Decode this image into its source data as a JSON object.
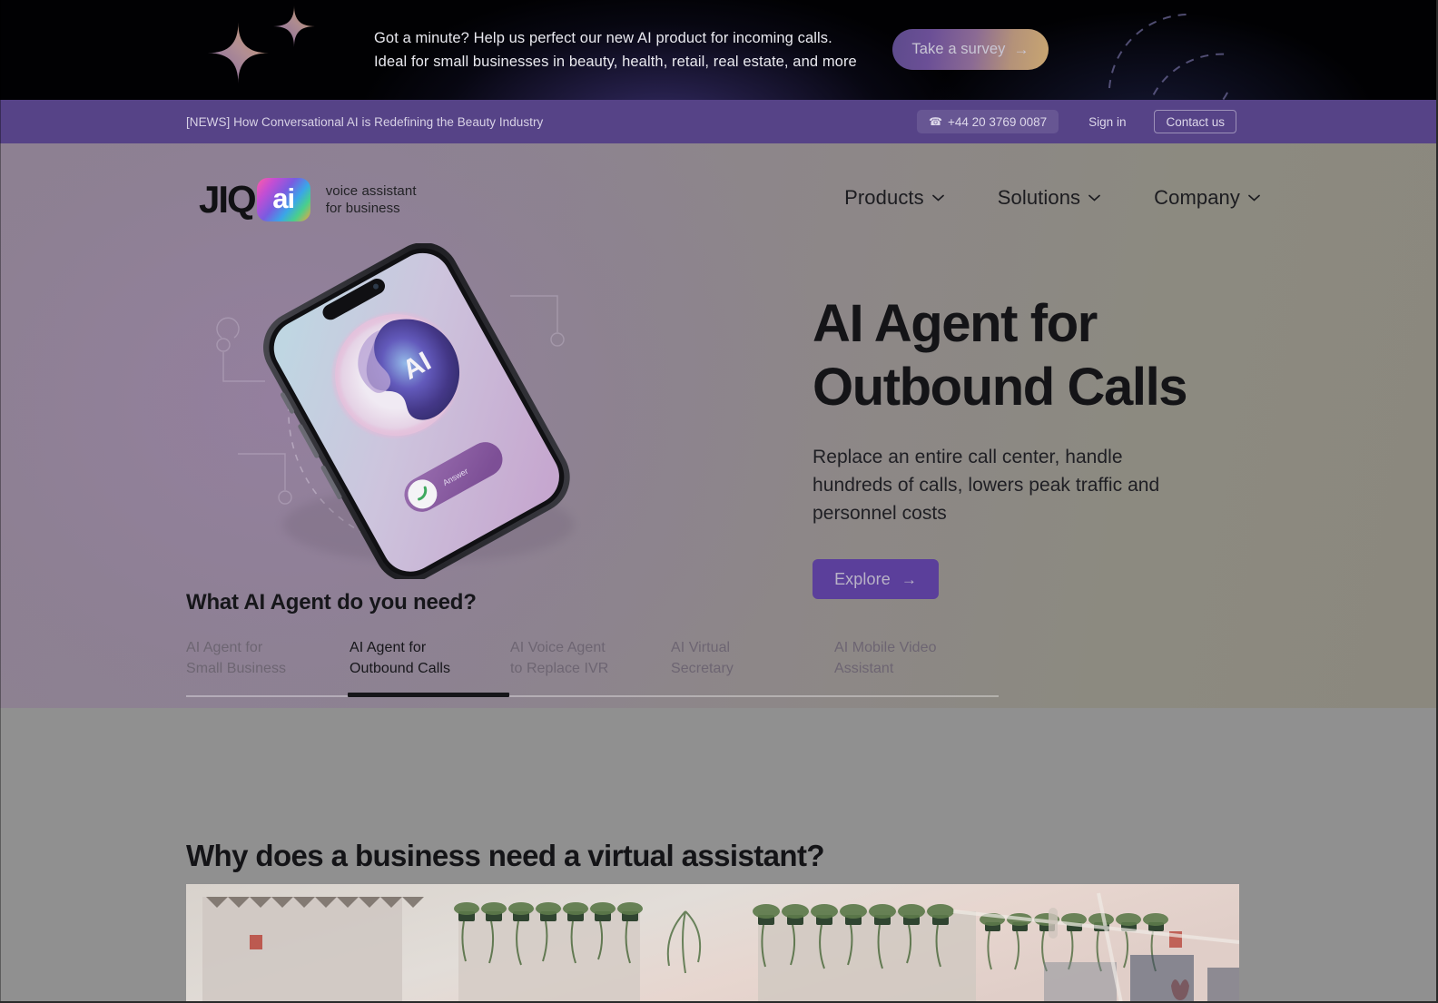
{
  "promo": {
    "highlight": "Got a minute?",
    "line1_rest": " Help us perfect our new AI product for incoming calls.",
    "line2": "Ideal for small businesses in beauty, health, retail, real estate, and more",
    "button_label": "Take a survey",
    "button_arrow": "→",
    "gradient_from": "#5d4b8c",
    "gradient_to": "#c9a671",
    "highlight_color": "#d79a4e"
  },
  "news_bar": {
    "news_text": "[NEWS] How Conversational AI is Redefining the Beauty Industry",
    "phone": "+44 20 3769 0087",
    "phone_icon": "phone-icon",
    "sign_in": "Sign in",
    "contact_us": "Contact us",
    "background": "#564387"
  },
  "brand": {
    "logo_text": "JIQ",
    "logo_badge": "ai",
    "tagline_line1": "voice assistant",
    "tagline_line2": "for business"
  },
  "nav": {
    "items": [
      {
        "label": "Products",
        "icon": "chevron-down-icon"
      },
      {
        "label": "Solutions",
        "icon": "chevron-down-icon"
      },
      {
        "label": "Company",
        "icon": "chevron-down-icon"
      }
    ]
  },
  "hero": {
    "title_line1": "AI Agent for",
    "title_line2": "Outbound Calls",
    "subtitle": "Replace an entire call center, handle hundreds of calls, lowers peak traffic and personnel costs",
    "cta_label": "Explore",
    "cta_arrow": "→",
    "cta_color": "#5b3f9b",
    "image_alt": "phone-mockup-ai-assistant"
  },
  "selector": {
    "title": "What AI Agent do you need?",
    "tabs": [
      {
        "label": "AI Agent for\nSmall Business",
        "active": false
      },
      {
        "label": "AI Agent for\nOutbound Calls",
        "active": true
      },
      {
        "label": "AI Voice Agent\nto Replace IVR",
        "active": false
      },
      {
        "label": "AI Virtual\nSecretary",
        "active": false
      },
      {
        "label": "AI Mobile Video\nAssistant",
        "active": false
      }
    ]
  },
  "section2": {
    "title": "Why does a business need a virtual assistant?",
    "media_alt": "office-interior-video"
  }
}
